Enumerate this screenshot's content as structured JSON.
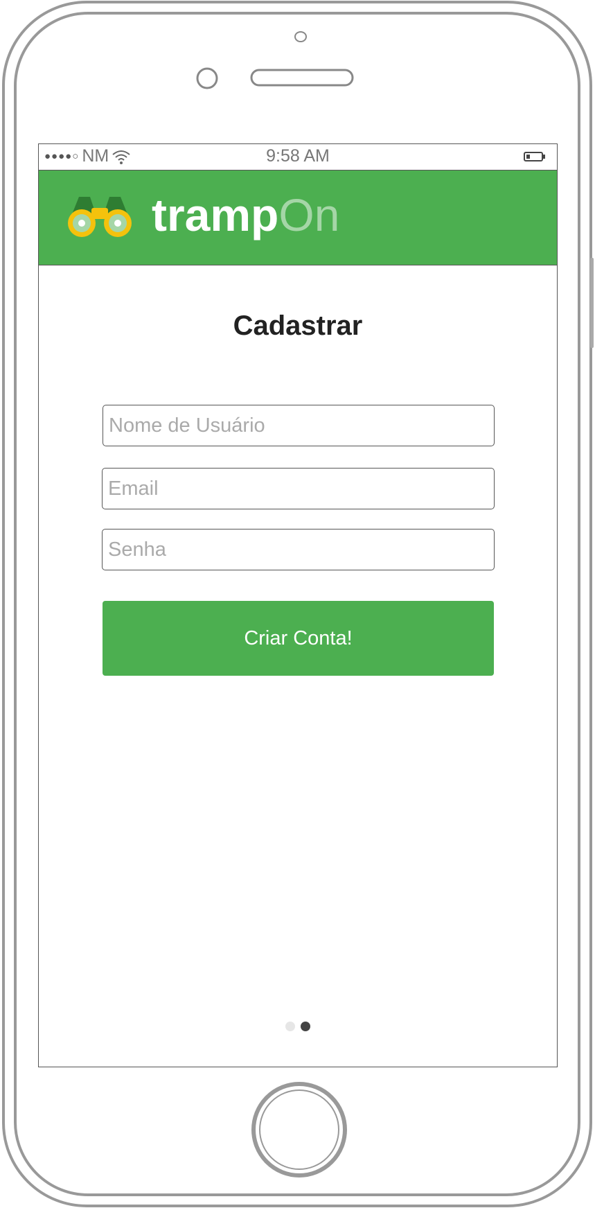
{
  "status_bar": {
    "signal": "●●●●○",
    "carrier": "NM",
    "time": "9:58 AM"
  },
  "header": {
    "logo_icon": "binoculars-icon",
    "logo_primary": "tramp",
    "logo_secondary": "On",
    "brand_color": "#4caf50",
    "logo_secondary_color": "#a5d6a7"
  },
  "form": {
    "title": "Cadastrar",
    "username_placeholder": "Nome de Usuário",
    "email_placeholder": "Email",
    "password_placeholder": "Senha",
    "username_value": "",
    "email_value": "",
    "password_value": "",
    "submit_label": "Criar Conta!"
  },
  "pager": {
    "total_pages": 2,
    "current_page": 2
  }
}
